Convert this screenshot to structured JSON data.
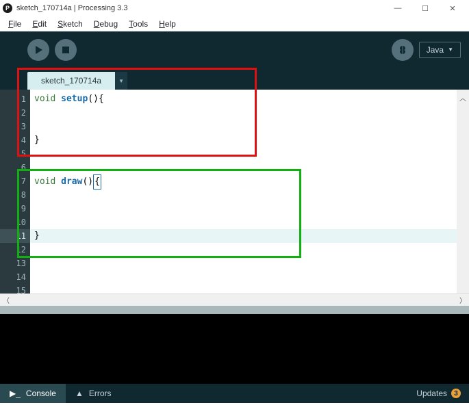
{
  "window": {
    "title": "sketch_170714a | Processing 3.3",
    "app_icon_letter": "P"
  },
  "menu": {
    "file": "File",
    "edit": "Edit",
    "sketch": "Sketch",
    "debug": "Debug",
    "tools": "Tools",
    "help": "Help"
  },
  "toolbar": {
    "mode_label": "Java"
  },
  "tabs": {
    "active": "sketch_170714a"
  },
  "code": {
    "lines": [
      {
        "n": 1,
        "kw": "void ",
        "fn": "setup",
        "rest": "(){"
      },
      {
        "n": 2
      },
      {
        "n": 3
      },
      {
        "n": 4,
        "text": "}"
      },
      {
        "n": 5
      },
      {
        "n": 6
      },
      {
        "n": 7,
        "kw": "void ",
        "fn": "draw",
        "rest": "()",
        "cursor": "{"
      },
      {
        "n": 8
      },
      {
        "n": 9
      },
      {
        "n": 10
      },
      {
        "n": 11,
        "text": "}",
        "current": true
      },
      {
        "n": 12
      },
      {
        "n": 13
      },
      {
        "n": 14
      },
      {
        "n": 15
      }
    ]
  },
  "footer": {
    "console": "Console",
    "errors": "Errors",
    "updates_label": "Updates",
    "updates_count": "3"
  }
}
